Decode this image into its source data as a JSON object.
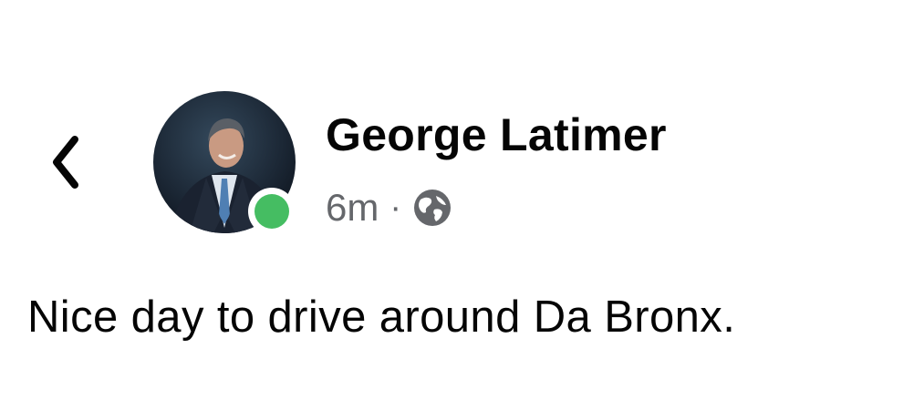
{
  "header": {
    "back_icon": "chevron-left-icon",
    "author_name": "George Latimer",
    "online_status_color": "#45bd62"
  },
  "meta": {
    "timestamp": "6m",
    "separator": "·",
    "privacy_icon": "globe-icon"
  },
  "post": {
    "text": "Nice day to drive around Da Bronx."
  }
}
